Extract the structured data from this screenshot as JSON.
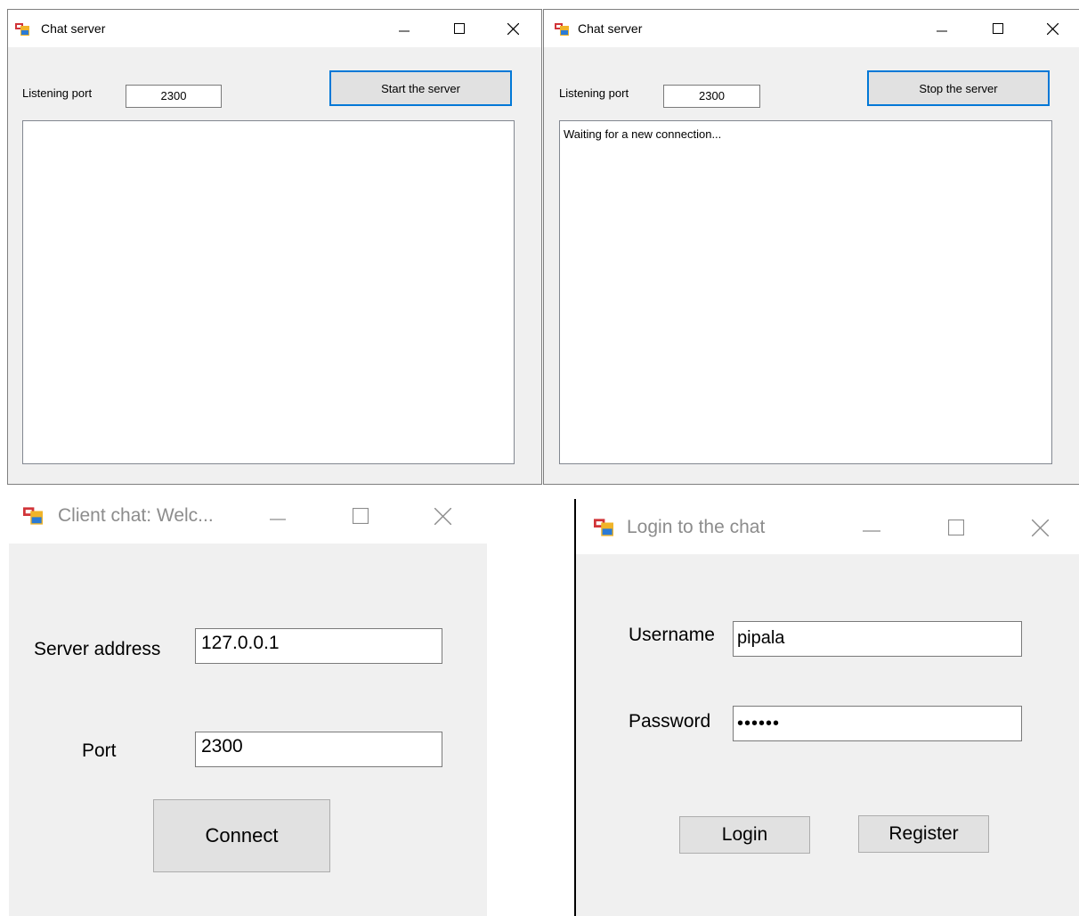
{
  "server_window_1": {
    "title": "Chat server",
    "listening_port_label": "Listening port",
    "port_value": "2300",
    "button_label": "Start the server",
    "log_text": ""
  },
  "server_window_2": {
    "title": "Chat server",
    "listening_port_label": "Listening port",
    "port_value": "2300",
    "button_label": "Stop the server",
    "log_text": "Waiting for a new connection..."
  },
  "client_window": {
    "title": "Client chat: Welc...",
    "server_address_label": "Server address",
    "server_address_value": "127.0.0.1",
    "port_label": "Port",
    "port_value": "2300",
    "connect_label": "Connect"
  },
  "login_window": {
    "title": "Login to the chat",
    "username_label": "Username",
    "username_value": "pipala",
    "password_label": "Password",
    "password_value": "••••••",
    "login_label": "Login",
    "register_label": "Register"
  },
  "colors": {
    "window_bg": "#f0f0f0",
    "titlebar_bg": "#ffffff",
    "focus_border": "#0078d7",
    "button_bg": "#e1e1e1"
  },
  "icons": [
    "app-form-icon",
    "minimize-icon",
    "maximize-icon",
    "close-icon"
  ]
}
